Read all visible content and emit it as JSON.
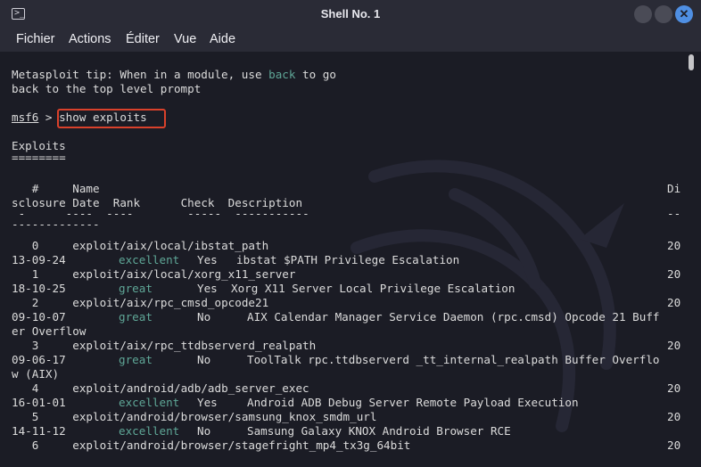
{
  "window": {
    "title": "Shell No. 1"
  },
  "menu": [
    "Fichier",
    "Actions",
    "Éditer",
    "Vue",
    "Aide"
  ],
  "terminal": {
    "tip": {
      "l1a": "Metasploit tip: When in a module, use ",
      "l1b": "back",
      "l1c": " to go",
      "l2": "back to the top level prompt"
    },
    "prompt": {
      "name": "msf6",
      "arrow": " > ",
      "command": "show exploits"
    },
    "section": {
      "title": "Exploits",
      "underline": "========"
    },
    "header": {
      "row1": {
        "num": "   #",
        "name": "     Name",
        "di": "Di"
      },
      "row2": {
        "a": "sclosure Date",
        "b": "  Rank",
        "c": "      Check",
        "d": "  Description"
      },
      "row3": {
        "a": " -",
        "b": "      ----",
        "c": "  ----",
        "d": "        -----",
        "e": "  -----------",
        "f": "--"
      }
    },
    "row_rule": "-------------",
    "exploits": [
      {
        "num": "   0",
        "path": "exploit/aix/local/ibstat_path",
        "year": "20",
        "date": "13-09-24",
        "rank": "excellent",
        "check": "Yes",
        "desc": "ibstat $PATH Privilege Escalation"
      },
      {
        "num": "   1",
        "path": "exploit/aix/local/xorg_x11_server",
        "year": "20",
        "date": "18-10-25",
        "rank": "great",
        "check": "Yes",
        "desc": "Xorg X11 Server Local Privilege Escalation"
      },
      {
        "num": "   2",
        "path": "exploit/aix/rpc_cmsd_opcode21",
        "year": "20",
        "date": "09-10-07",
        "rank": "great",
        "check": "No",
        "desc": "AIX Calendar Manager Service Daemon (rpc.cmsd) Opcode 21 Buff",
        "wrap": "er Overflow"
      },
      {
        "num": "   3",
        "path": "exploit/aix/rpc_ttdbserverd_realpath",
        "year": "20",
        "date": "09-06-17",
        "rank": "great",
        "check": "No",
        "desc": "ToolTalk rpc.ttdbserverd _tt_internal_realpath Buffer Overflo",
        "wrap": "w (AIX)"
      },
      {
        "num": "   4",
        "path": "exploit/android/adb/adb_server_exec",
        "year": "20",
        "date": "16-01-01",
        "rank": "excellent",
        "check": "Yes",
        "desc": "Android ADB Debug Server Remote Payload Execution"
      },
      {
        "num": "   5",
        "path": "exploit/android/browser/samsung_knox_smdm_url",
        "year": "20",
        "date": "14-11-12",
        "rank": "excellent",
        "check": "No",
        "desc": "Samsung Galaxy KNOX Android Browser RCE"
      },
      {
        "num": "   6",
        "path": "exploit/android/browser/stagefright_mp4_tx3g_64bit",
        "year": "20"
      }
    ]
  }
}
